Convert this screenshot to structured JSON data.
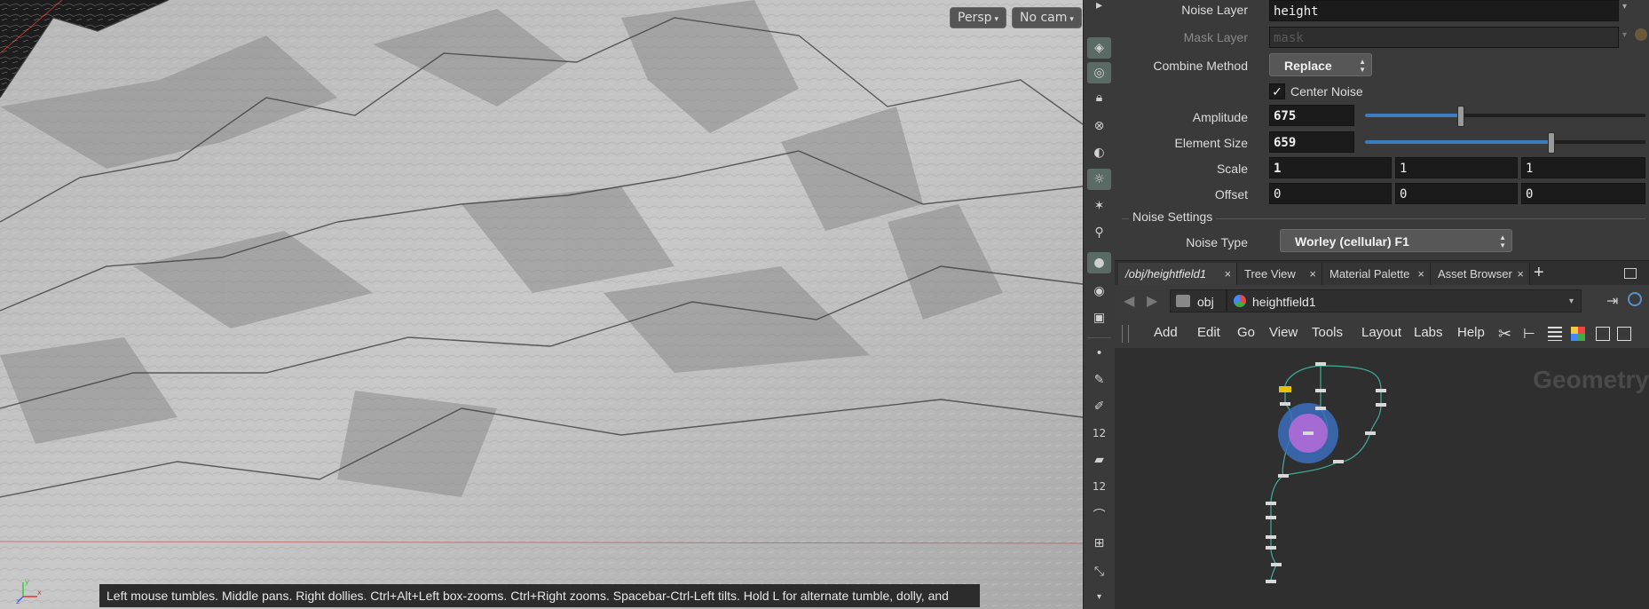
{
  "viewport": {
    "persp_label": "Persp",
    "cam_label": "No cam",
    "status_text": "Left mouse tumbles. Middle pans. Right dollies. Ctrl+Alt+Left box-zooms. Ctrl+Right zooms. Spacebar-Ctrl-Left tilts. Hold L for alternate tumble, dolly, and zoom.",
    "axis_labels": {
      "x": "x",
      "y": "y",
      "z": "z"
    }
  },
  "toolbar": {
    "icons": [
      "display-options-icon",
      "ghost-icon",
      "lock-icon",
      "close-circle-icon",
      "headlight-icon",
      "light-bulb-icon",
      "point-light-icon",
      "spot-light-icon",
      "render-sphere-icon",
      "eye-camera-icon",
      "camera-icon",
      "point-icon",
      "brush-icon",
      "pin-icon",
      "number-icon",
      "stamp-icon",
      "number-icon",
      "curve-icon",
      "transform-icon",
      "handle-icon"
    ],
    "number_label_1": "12",
    "number_label_2": "12"
  },
  "params": {
    "noise_layer": {
      "label": "Noise Layer",
      "value": "height"
    },
    "mask_layer": {
      "label": "Mask Layer",
      "value": "mask"
    },
    "combine_method": {
      "label": "Combine Method",
      "value": "Replace"
    },
    "center_noise": {
      "label": "Center Noise",
      "checked": true
    },
    "amplitude": {
      "label": "Amplitude",
      "value": "675",
      "slider_fraction": 0.34
    },
    "element_size": {
      "label": "Element Size",
      "value": "659",
      "slider_fraction": 0.66
    },
    "scale": {
      "label": "Scale",
      "values": [
        "1",
        "1",
        "1"
      ]
    },
    "offset": {
      "label": "Offset",
      "values": [
        "0",
        "0",
        "0"
      ]
    },
    "noise_settings": {
      "label": "Noise Settings"
    },
    "noise_type": {
      "label": "Noise Type",
      "value": "Worley (cellular) F1"
    }
  },
  "tabs": [
    {
      "label": "/obj/heightfield1",
      "active": true
    },
    {
      "label": "Tree View"
    },
    {
      "label": "Material Palette"
    },
    {
      "label": "Asset Browser"
    }
  ],
  "pathbar": {
    "root": "obj",
    "node": "heightfield1"
  },
  "menubar": {
    "items": [
      "Add",
      "Edit",
      "Go",
      "View",
      "Tools",
      "Layout",
      "Labs",
      "Help"
    ]
  },
  "network": {
    "context_label": "Geometry"
  },
  "colors": {
    "accent_blue": "#3c7cc0",
    "wire_teal": "#3fae9a",
    "selected_yellow": "#e6c200"
  }
}
